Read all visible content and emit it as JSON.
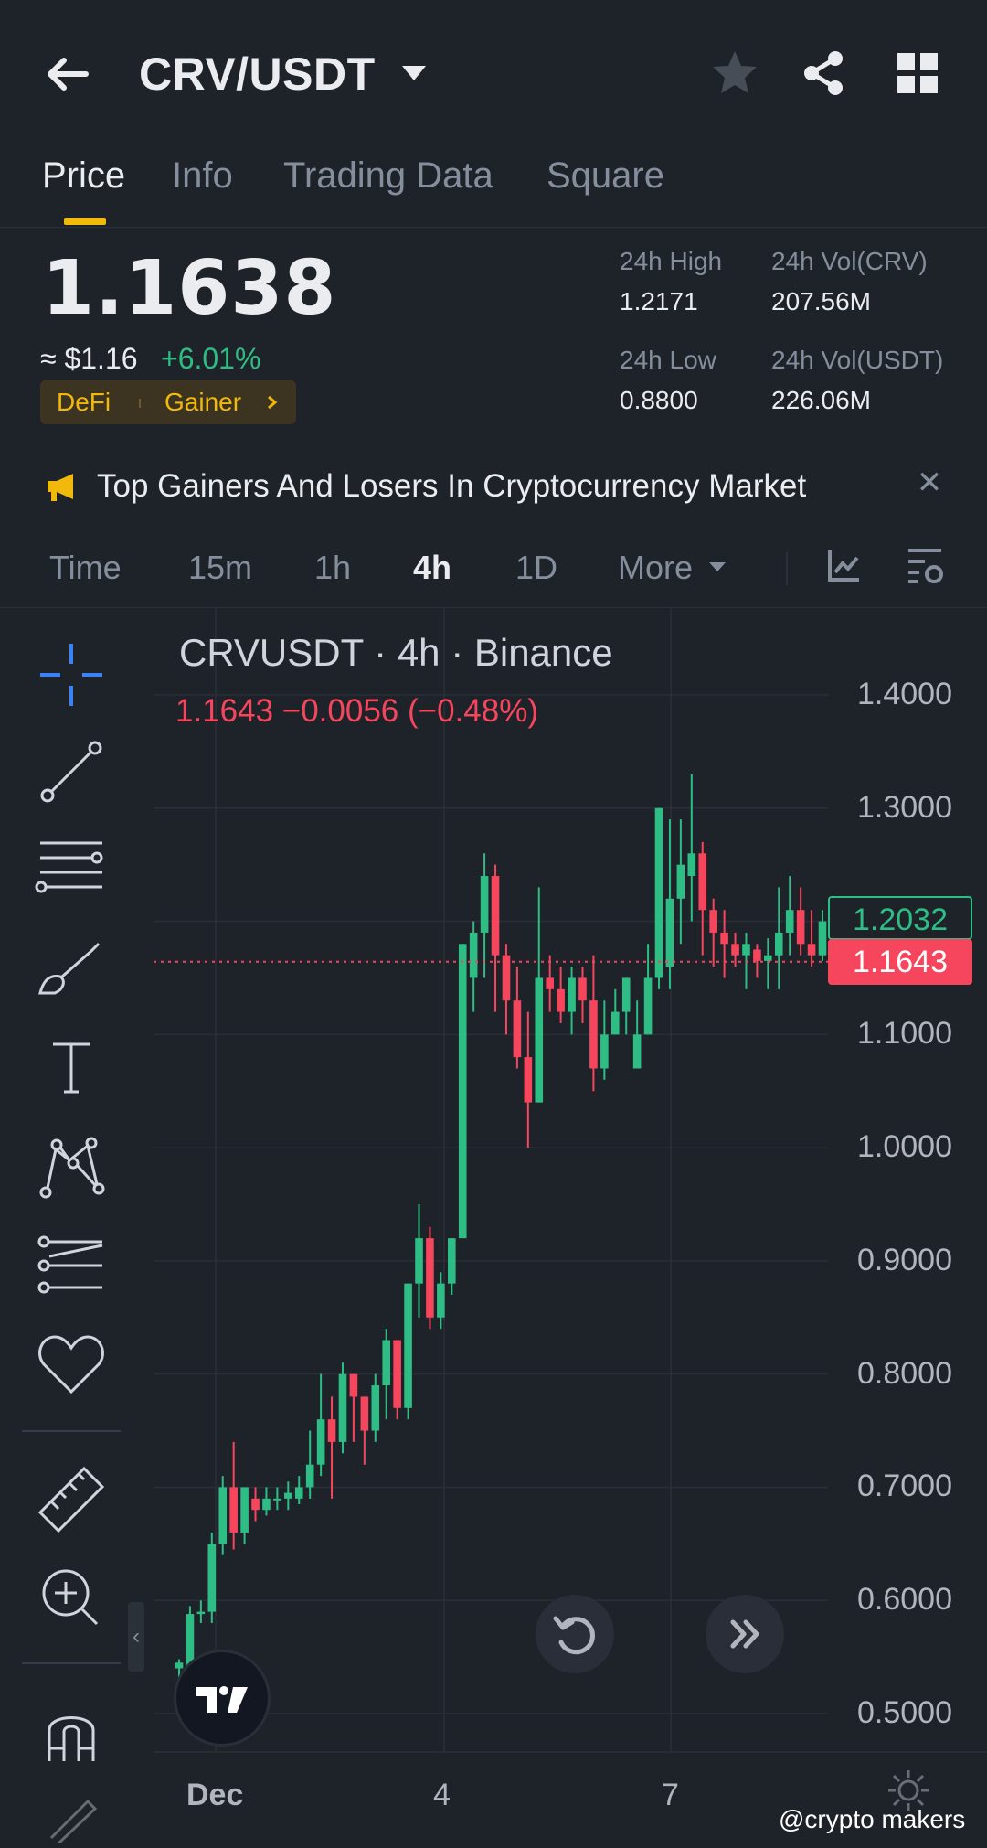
{
  "header": {
    "pair": "CRV/USDT",
    "icons": [
      "back-arrow-icon",
      "caret-down-icon",
      "star-icon",
      "share-icon",
      "grid-icon"
    ]
  },
  "tabs": [
    {
      "label": "Price",
      "active": true
    },
    {
      "label": "Info",
      "active": false
    },
    {
      "label": "Trading Data",
      "active": false
    },
    {
      "label": "Square",
      "active": false
    }
  ],
  "ticker": {
    "last_price": "1.1638",
    "fiat_price": "≈ $1.16",
    "change_pct": "+6.01%",
    "tags": [
      "DeFi",
      "Gainer"
    ],
    "stats": {
      "high_label": "24h High",
      "high_value": "1.2171",
      "low_label": "24h Low",
      "low_value": "0.8800",
      "vol_crv_label": "24h Vol(CRV)",
      "vol_crv_value": "207.56M",
      "vol_usdt_label": "24h Vol(USDT)",
      "vol_usdt_value": "226.06M"
    }
  },
  "banner": {
    "text": "Top Gainers And Losers In Cryptocurrency Market",
    "close": "✕"
  },
  "timeframes": {
    "items": [
      "Time",
      "15m",
      "1h",
      "4h",
      "1D"
    ],
    "active": "4h",
    "more_label": "More"
  },
  "chart": {
    "title": "CRVUSDT · 4h · Binance",
    "ohlc_line": "1.1643  −0.0056 (−0.48%)",
    "y_ticks": [
      "1.4000",
      "1.3000",
      "1.2000",
      "1.1000",
      "1.0000",
      "0.9000",
      "0.8000",
      "0.7000",
      "0.6000",
      "0.5000"
    ],
    "x_ticks": [
      "Dec",
      "4",
      "7"
    ],
    "price_label_green": "1.2032",
    "price_label_red": "1.1643",
    "watermark": "@crypto makers",
    "colors": {
      "up": "#2ebd85",
      "down": "#f6465d",
      "accent": "#f0b90b",
      "bg": "#1e2329"
    }
  },
  "chart_data": {
    "type": "candlestick",
    "title": "CRVUSDT · 4h · Binance",
    "xlabel": "",
    "ylabel": "",
    "ylim": [
      0.47,
      1.43
    ],
    "y_ticks": [
      0.5,
      0.6,
      0.7,
      0.8,
      0.9,
      1.0,
      1.1,
      1.2,
      1.3,
      1.4
    ],
    "x_ticks": [
      "Dec",
      "4",
      "7"
    ],
    "candles": [
      [
        0.54,
        0.545,
        0.53,
        0.548
      ],
      [
        0.535,
        0.588,
        0.528,
        0.595
      ],
      [
        0.588,
        0.59,
        0.58,
        0.6
      ],
      [
        0.59,
        0.65,
        0.58,
        0.66
      ],
      [
        0.65,
        0.7,
        0.64,
        0.71
      ],
      [
        0.7,
        0.66,
        0.645,
        0.74
      ],
      [
        0.66,
        0.7,
        0.65,
        0.7
      ],
      [
        0.69,
        0.68,
        0.67,
        0.7
      ],
      [
        0.68,
        0.69,
        0.675,
        0.7
      ],
      [
        0.69,
        0.69,
        0.68,
        0.7
      ],
      [
        0.69,
        0.695,
        0.68,
        0.705
      ],
      [
        0.69,
        0.7,
        0.685,
        0.71
      ],
      [
        0.7,
        0.72,
        0.69,
        0.75
      ],
      [
        0.72,
        0.76,
        0.71,
        0.8
      ],
      [
        0.76,
        0.74,
        0.69,
        0.78
      ],
      [
        0.74,
        0.8,
        0.73,
        0.81
      ],
      [
        0.8,
        0.78,
        0.74,
        0.8
      ],
      [
        0.78,
        0.75,
        0.72,
        0.78
      ],
      [
        0.75,
        0.79,
        0.74,
        0.8
      ],
      [
        0.79,
        0.83,
        0.76,
        0.84
      ],
      [
        0.83,
        0.77,
        0.76,
        0.81
      ],
      [
        0.77,
        0.88,
        0.76,
        0.88
      ],
      [
        0.88,
        0.92,
        0.85,
        0.95
      ],
      [
        0.92,
        0.85,
        0.84,
        0.93
      ],
      [
        0.85,
        0.88,
        0.84,
        0.89
      ],
      [
        0.88,
        0.92,
        0.87,
        0.92
      ],
      [
        0.92,
        1.18,
        0.92,
        1.18
      ],
      [
        1.15,
        1.19,
        1.12,
        1.2
      ],
      [
        1.19,
        1.24,
        1.15,
        1.26
      ],
      [
        1.24,
        1.17,
        1.12,
        1.25
      ],
      [
        1.17,
        1.13,
        1.1,
        1.18
      ],
      [
        1.13,
        1.08,
        1.07,
        1.16
      ],
      [
        1.08,
        1.04,
        1.0,
        1.12
      ],
      [
        1.04,
        1.15,
        1.04,
        1.23
      ],
      [
        1.15,
        1.14,
        1.12,
        1.17
      ],
      [
        1.14,
        1.12,
        1.11,
        1.16
      ],
      [
        1.12,
        1.15,
        1.1,
        1.16
      ],
      [
        1.15,
        1.13,
        1.11,
        1.16
      ],
      [
        1.13,
        1.07,
        1.05,
        1.17
      ],
      [
        1.07,
        1.1,
        1.06,
        1.13
      ],
      [
        1.1,
        1.12,
        1.1,
        1.14
      ],
      [
        1.12,
        1.15,
        1.1,
        1.15
      ],
      [
        1.07,
        1.1,
        1.07,
        1.13
      ],
      [
        1.1,
        1.15,
        1.1,
        1.18
      ],
      [
        1.15,
        1.3,
        1.14,
        1.3
      ],
      [
        1.16,
        1.22,
        1.14,
        1.29
      ],
      [
        1.22,
        1.25,
        1.18,
        1.29
      ],
      [
        1.24,
        1.26,
        1.2,
        1.33
      ],
      [
        1.26,
        1.21,
        1.17,
        1.27
      ],
      [
        1.21,
        1.19,
        1.16,
        1.22
      ],
      [
        1.19,
        1.18,
        1.15,
        1.21
      ],
      [
        1.18,
        1.17,
        1.16,
        1.19
      ],
      [
        1.17,
        1.18,
        1.14,
        1.19
      ],
      [
        1.175,
        1.165,
        1.15,
        1.18
      ],
      [
        1.165,
        1.17,
        1.14,
        1.185
      ],
      [
        1.17,
        1.19,
        1.14,
        1.23
      ],
      [
        1.19,
        1.21,
        1.17,
        1.24
      ],
      [
        1.21,
        1.18,
        1.17,
        1.23
      ],
      [
        1.18,
        1.17,
        1.16,
        1.21
      ],
      [
        1.17,
        1.2,
        1.165,
        1.21
      ]
    ],
    "series": [
      {
        "values_format": "[open, close, low, high]"
      }
    ],
    "last_price": 1.1643,
    "label_price": 1.2032,
    "grid": true
  }
}
